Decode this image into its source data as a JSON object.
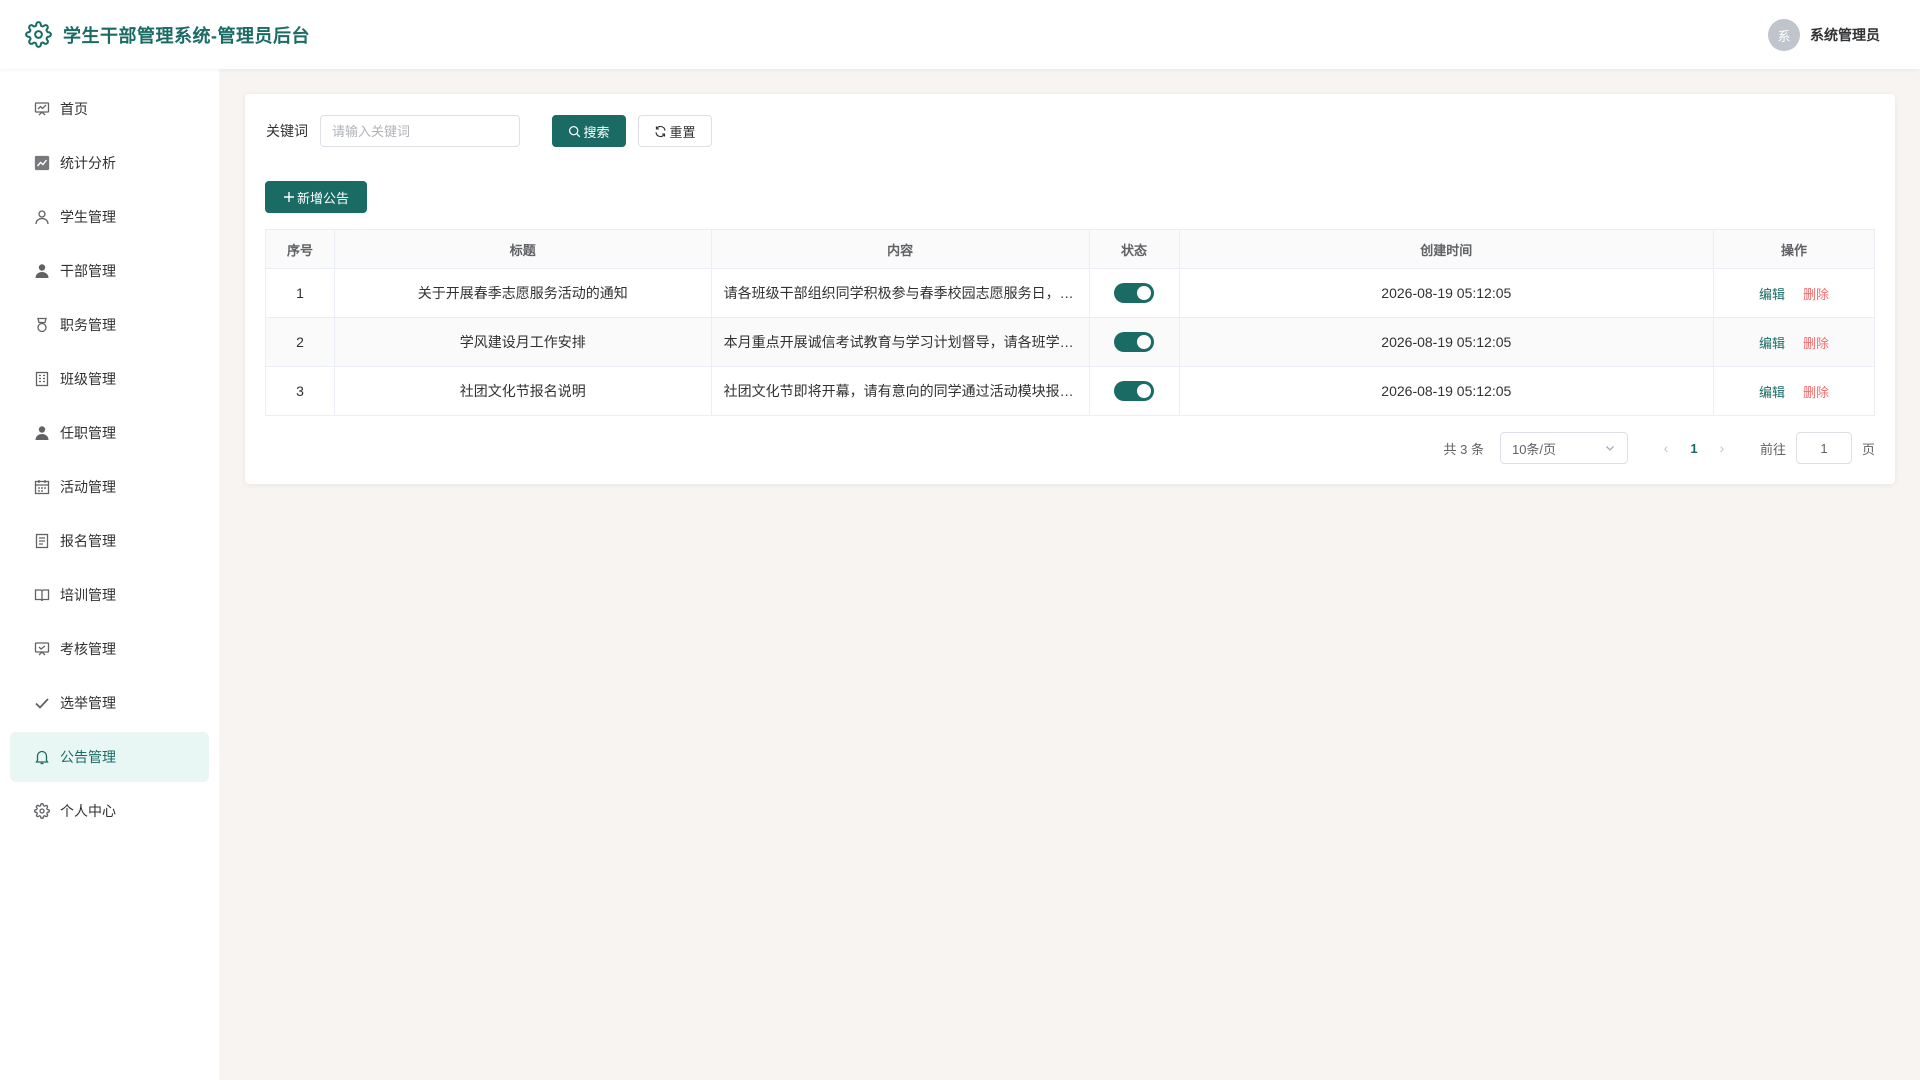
{
  "header": {
    "title": "学生干部管理系统-管理员后台",
    "avatar_text": "系",
    "username": "系统管理员"
  },
  "sidebar": {
    "items": [
      {
        "label": "首页",
        "icon": "dashboard-icon"
      },
      {
        "label": "统计分析",
        "icon": "chart-icon"
      },
      {
        "label": "学生管理",
        "icon": "user-outline-icon"
      },
      {
        "label": "干部管理",
        "icon": "user-filled-icon"
      },
      {
        "label": "职务管理",
        "icon": "medal-icon"
      },
      {
        "label": "班级管理",
        "icon": "building-icon"
      },
      {
        "label": "任职管理",
        "icon": "user-filled-icon"
      },
      {
        "label": "活动管理",
        "icon": "calendar-icon"
      },
      {
        "label": "报名管理",
        "icon": "document-icon"
      },
      {
        "label": "培训管理",
        "icon": "book-icon"
      },
      {
        "label": "考核管理",
        "icon": "monitor-icon"
      },
      {
        "label": "选举管理",
        "icon": "check-icon"
      },
      {
        "label": "公告管理",
        "icon": "bell-icon",
        "active": true
      },
      {
        "label": "个人中心",
        "icon": "gear-icon"
      }
    ]
  },
  "search": {
    "label": "关键词",
    "placeholder": "请输入关键词",
    "value": "",
    "search_label": "搜索",
    "reset_label": "重置"
  },
  "add_button_label": "新增公告",
  "table": {
    "headers": [
      "序号",
      "标题",
      "内容",
      "状态",
      "创建时间",
      "操作"
    ],
    "rows": [
      {
        "index": "1",
        "title": "关于开展春季志愿服务活动的通知",
        "content": "请各班级干部组织同学积极参与春季校园志愿服务日，…",
        "enabled": true,
        "created": "2026-08-19 05:12:05"
      },
      {
        "index": "2",
        "title": "学风建设月工作安排",
        "content": "本月重点开展诚信考试教育与学习计划督导，请各班学…",
        "enabled": true,
        "created": "2026-08-19 05:12:05"
      },
      {
        "index": "3",
        "title": "社团文化节报名说明",
        "content": "社团文化节即将开幕，请有意向的同学通过活动模块报…",
        "enabled": true,
        "created": "2026-08-19 05:12:05"
      }
    ],
    "edit_label": "编辑",
    "delete_label": "删除"
  },
  "pagination": {
    "total": "共 3 条",
    "page_size": "10条/页",
    "current_page": "1",
    "goto_label": "前往",
    "goto_value": "1",
    "page_suffix": "页"
  },
  "colors": {
    "primary": "#1a6b64",
    "danger": "#f56c6c",
    "active_bg": "#e8f7f4",
    "page_bg": "#f7f4f1"
  }
}
